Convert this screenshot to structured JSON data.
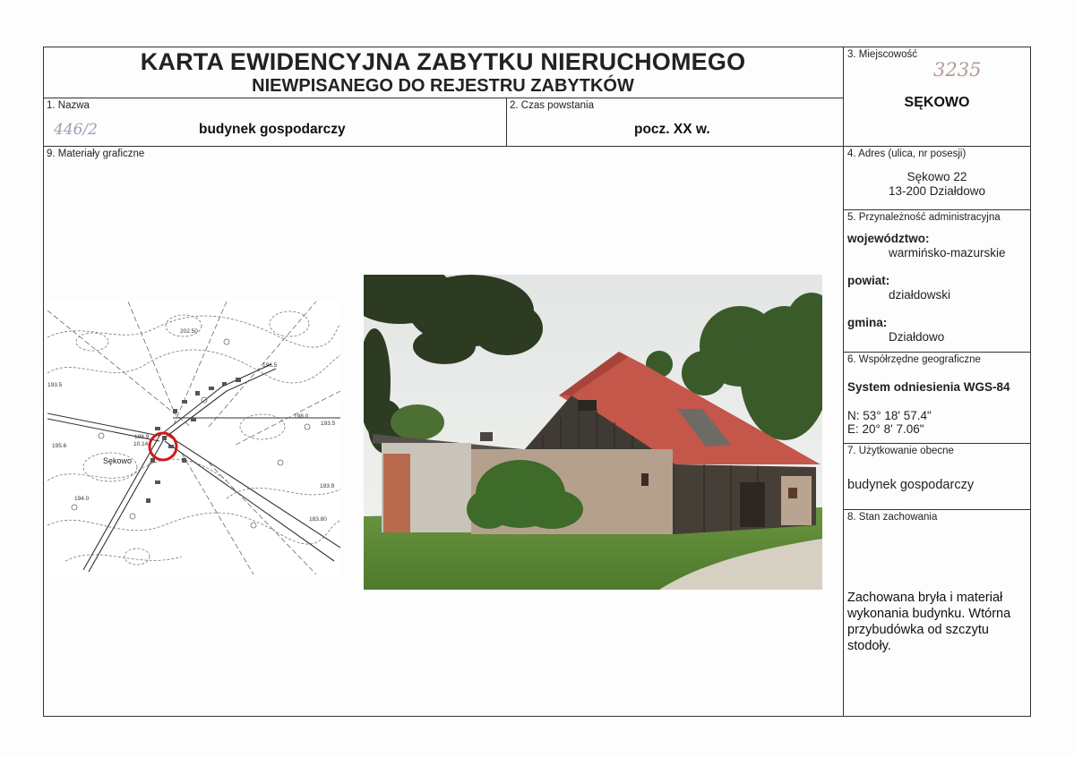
{
  "header": {
    "title": "KARTA EWIDENCYJNA ZABYTKU NIERUCHOMEGO",
    "subtitle": "NIEWPISANEGO DO REJESTRU ZABYTKÓW"
  },
  "fields": {
    "nazwa": {
      "label": "1. Nazwa",
      "value": "budynek gospodarczy",
      "handwritten_ref": "446/2"
    },
    "czas_powstania": {
      "label": "2. Czas powstania",
      "value": "pocz. XX w."
    },
    "miejscowosc": {
      "label": "3. Miejscowość",
      "value": "SĘKOWO",
      "handwritten_ref": "3235"
    },
    "adres": {
      "label": "4. Adres (ulica, nr posesji)",
      "line1": "Sękowo 22",
      "line2": "13-200 Działdowo"
    },
    "przynaleznosc": {
      "label": "5. Przynależność administracyjna",
      "wojewodztwo_label": "województwo:",
      "wojewodztwo": "warmińsko-mazurskie",
      "powiat_label": "powiat:",
      "powiat": "działdowski",
      "gmina_label": "gmina:",
      "gmina": "Działdowo"
    },
    "wspolrzedne": {
      "label": "6. Współrzędne geograficzne",
      "system": "System odniesienia WGS-84",
      "n": "N: 53° 18' 57.4\"",
      "e": "E: 20° 8' 7.06\""
    },
    "uzytkowanie": {
      "label": "7. Użytkowanie obecne",
      "value": "budynek gospodarczy"
    },
    "stan": {
      "label": "8. Stan zachowania",
      "lines": [
        "Zachowana bryła i materiał",
        "wykonania budynku. Wtórna",
        "przybudówka od szczytu",
        "stodoły."
      ]
    },
    "materialy": {
      "label": "9. Materiały graficzne"
    }
  },
  "map": {
    "place_label": "Sękowo",
    "spot_heights": [
      "202.50",
      "196.5",
      "198.0",
      "193.5",
      "195.6",
      "193.5",
      "198.9",
      "10.14",
      "183.80",
      "193.9",
      "194.0"
    ]
  },
  "colors": {
    "roof": "#c5564a",
    "marker": "#d01818",
    "wood": "#3f3a34",
    "grass": "#5d8a3a"
  }
}
